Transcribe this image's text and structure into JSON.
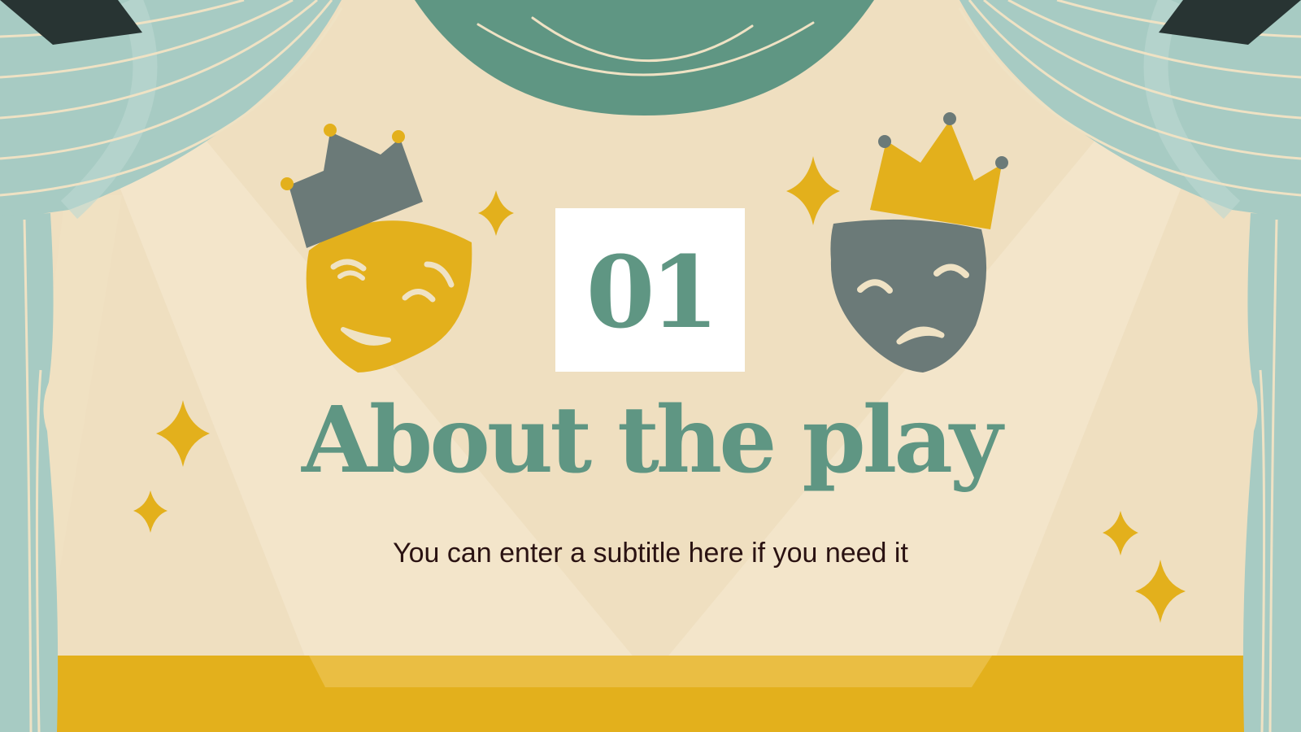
{
  "slide": {
    "number": "01",
    "title": "About the play",
    "subtitle": "You can enter a subtitle here if you need it"
  },
  "icons": {
    "comedy_mask": "comedy-mask-icon",
    "tragedy_mask": "tragedy-mask-icon",
    "crown": "crown-icon",
    "sparkle": "sparkle-icon",
    "spotlight": "spotlight-icon",
    "curtain": "curtain-icon"
  },
  "colors": {
    "background": "#efdfc0",
    "teal": "#5f9683",
    "curtain": "#a7cbc3",
    "gold": "#e3b01c",
    "gray": "#6b7a78",
    "text_dark": "#2a1212"
  }
}
